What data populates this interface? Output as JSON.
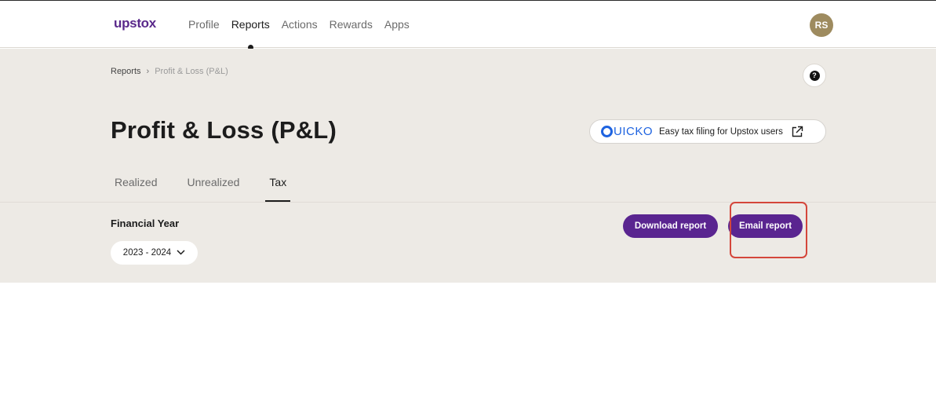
{
  "brand": {
    "logo_text": "upstox"
  },
  "nav": {
    "items": [
      {
        "label": "Profile"
      },
      {
        "label": "Reports"
      },
      {
        "label": "Actions"
      },
      {
        "label": "Rewards"
      },
      {
        "label": "Apps"
      }
    ],
    "active": "Reports"
  },
  "user": {
    "initials": "RS"
  },
  "breadcrumb": {
    "parent": "Reports",
    "separator": "›",
    "current": "Profit & Loss (P&L)"
  },
  "help": {
    "symbol": "?"
  },
  "page": {
    "title": "Profit & Loss (P&L)"
  },
  "quicko": {
    "brand": "UICKO",
    "text": "Easy tax filing for Upstox users"
  },
  "tabs": [
    {
      "label": "Realized"
    },
    {
      "label": "Unrealized"
    },
    {
      "label": "Tax"
    }
  ],
  "active_tab": "Tax",
  "financial_year": {
    "label": "Financial Year",
    "selected": "2023 - 2024"
  },
  "actions": {
    "download": "Download report",
    "email": "Email report"
  },
  "colors": {
    "brand_purple": "#5a2590",
    "panel_bg": "#edeae5",
    "highlight": "#d4463b",
    "quicko_blue": "#1e63e0",
    "avatar": "#9e8b5f"
  }
}
